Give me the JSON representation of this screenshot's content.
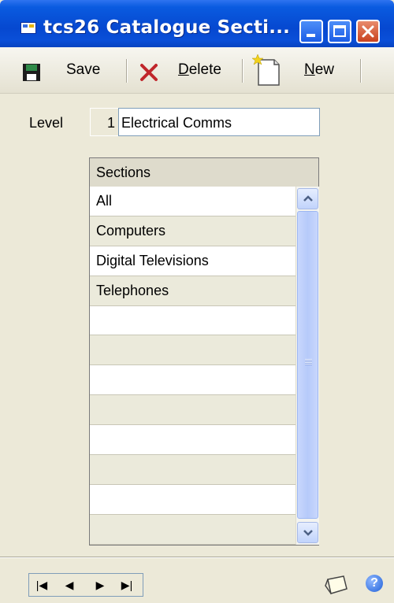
{
  "window": {
    "title": "tcs26 Catalogue Secti...",
    "controls": {
      "minimize": "minimize",
      "maximize": "maximize",
      "close": "close"
    }
  },
  "toolbar": {
    "save_label": "Save",
    "delete_label": "Delete",
    "delete_accel": "D",
    "delete_rest": "elete",
    "new_label": "New",
    "new_accel": "N",
    "new_rest": "ew"
  },
  "level": {
    "label": "Level",
    "number": "1",
    "value": "Electrical Comms"
  },
  "sections": {
    "header": "Sections",
    "rows": [
      "All",
      "Computers",
      "Digital Televisions",
      "Telephones",
      "",
      "",
      "",
      "",
      "",
      "",
      "",
      ""
    ]
  },
  "navigation": {
    "first": "|◀",
    "prev": "◀",
    "next": "▶",
    "last": "▶|"
  },
  "icons": {
    "note": "note-icon",
    "help": "help-icon"
  },
  "colors": {
    "titlebar": "#0648d0",
    "window_bg": "#ece9d8",
    "row_alt": "#ebeadb",
    "delete_x": "#c0262b"
  }
}
